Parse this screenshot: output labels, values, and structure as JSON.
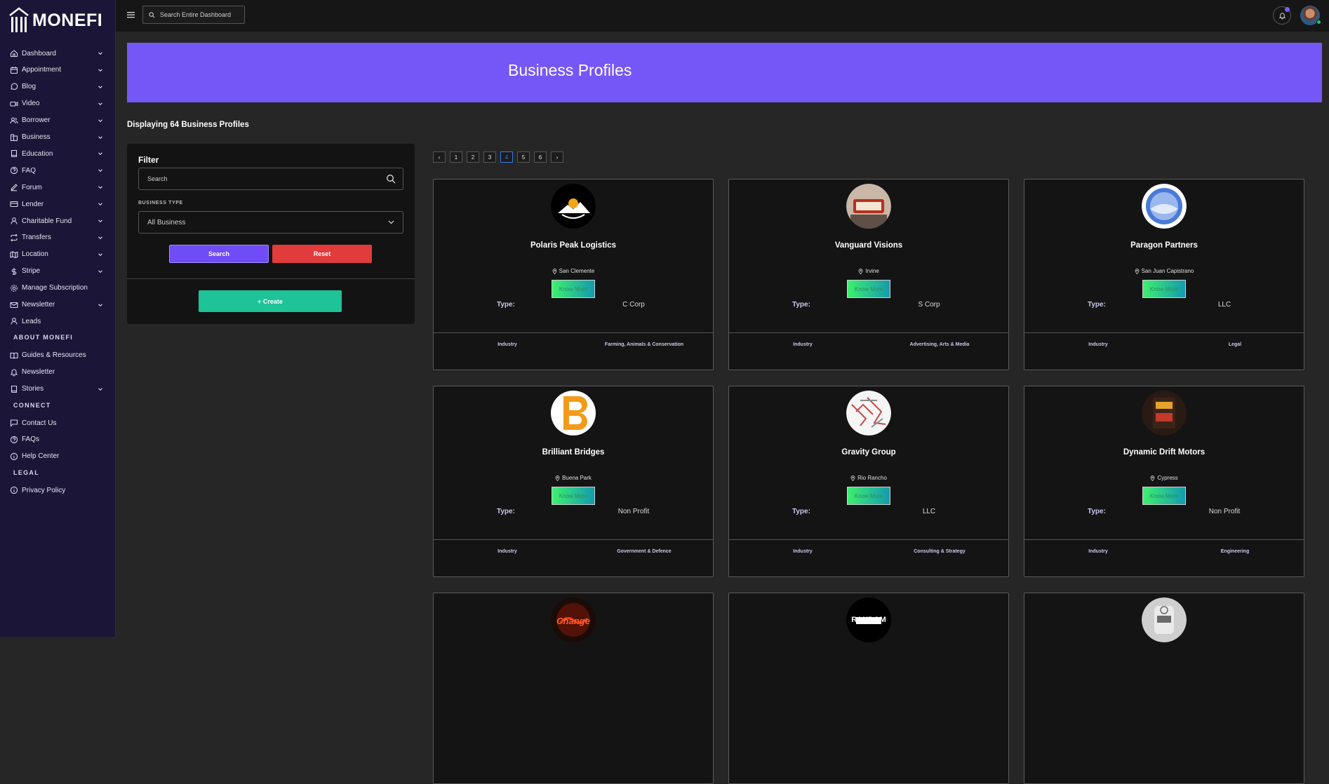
{
  "brand": {
    "name": "MONEFI"
  },
  "topbar": {
    "search_placeholder": "Search Entire Dashboard"
  },
  "sidebar": {
    "items": [
      {
        "label": "Dashboard",
        "icon": "home-icon",
        "chevron": true
      },
      {
        "label": "Appointment",
        "icon": "calendar-icon",
        "chevron": true
      },
      {
        "label": "Blog",
        "icon": "chat-icon",
        "chevron": true
      },
      {
        "label": "Video",
        "icon": "video-icon",
        "chevron": true
      },
      {
        "label": "Borrower",
        "icon": "users-icon",
        "chevron": true
      },
      {
        "label": "Business",
        "icon": "building-icon",
        "chevron": true
      },
      {
        "label": "Education",
        "icon": "book-icon",
        "chevron": true
      },
      {
        "label": "FAQ",
        "icon": "help-circle-icon",
        "chevron": true
      },
      {
        "label": "Forum",
        "icon": "edit-icon",
        "chevron": true
      },
      {
        "label": "Lender",
        "icon": "card-icon",
        "chevron": true
      },
      {
        "label": "Charitable Fund",
        "icon": "user-icon",
        "chevron": true
      },
      {
        "label": "Transfers",
        "icon": "repeat-icon",
        "chevron": true
      },
      {
        "label": "Location",
        "icon": "map-icon",
        "chevron": true
      },
      {
        "label": "Stripe",
        "icon": "dollar-icon",
        "chevron": true
      },
      {
        "label": "Manage Subscription",
        "icon": "settings-icon",
        "chevron": false
      },
      {
        "label": "Newsletter",
        "icon": "mail-icon",
        "chevron": true
      },
      {
        "label": "Leads",
        "icon": "user-icon",
        "chevron": false
      }
    ],
    "section_about": "ABOUT MONEFI",
    "about_items": [
      {
        "label": "Guides & Resources",
        "icon": "book-open-icon",
        "chevron": false
      },
      {
        "label": "Newsletter",
        "icon": "bell-icon",
        "chevron": false
      },
      {
        "label": "Stories",
        "icon": "book-icon",
        "chevron": true
      }
    ],
    "section_connect": "CONNECT",
    "connect_items": [
      {
        "label": "Contact Us",
        "icon": "message-icon",
        "chevron": false
      },
      {
        "label": "FAQs",
        "icon": "help-circle-icon",
        "chevron": false
      },
      {
        "label": "Help Center",
        "icon": "info-icon",
        "chevron": false
      }
    ],
    "section_legal": "LEGAL",
    "legal_items": [
      {
        "label": "Privacy Policy",
        "icon": "info-icon",
        "chevron": false
      }
    ]
  },
  "banner": {
    "title": "Business Profiles"
  },
  "summary": "Displaying 64 Business Profiles",
  "filter": {
    "title": "Filter",
    "search_placeholder": "Search",
    "business_type_label": "BUSINESS TYPE",
    "business_type_value": "All Business",
    "search_button": "Search",
    "reset_button": "Reset",
    "create_button": "+ Create"
  },
  "pagination": {
    "prev": "‹",
    "next": "›",
    "pages": [
      "1",
      "2",
      "3",
      "4",
      "5",
      "6"
    ],
    "active": "4"
  },
  "cards": [
    {
      "name": "Polaris Peak Logistics",
      "location": "San Clemente",
      "button": "Know More",
      "type_label": "Type:",
      "type": "C Corp",
      "industry_label": "Industry",
      "industry": "Farming, Animals & Conservation",
      "logo_colors": [
        "#000000",
        "#f2a51a",
        "#ffffff"
      ]
    },
    {
      "name": "Vanguard Visions",
      "location": "Irvine",
      "button": "Know More",
      "type_label": "Type:",
      "type": "S Corp",
      "industry_label": "Industry",
      "industry": "Advertising, Arts & Media",
      "logo_colors": [
        "#c9b7a8",
        "#b83020",
        "#5e5046"
      ]
    },
    {
      "name": "Paragon Partners",
      "location": "San Juan Capistrano",
      "button": "Know More",
      "type_label": "Type:",
      "type": "LLC",
      "industry_label": "Industry",
      "industry": "Legal",
      "logo_colors": [
        "#ffffff",
        "#4a7ad8",
        "#9ab8ee"
      ]
    },
    {
      "name": "Brilliant Bridges",
      "location": "Buena Park",
      "button": "Know More",
      "type_label": "Type:",
      "type": "Non Profit",
      "industry_label": "Industry",
      "industry": "Government & Defence",
      "logo_colors": [
        "#ffffff",
        "#f39a1b",
        "#2b2b2b"
      ]
    },
    {
      "name": "Gravity Group",
      "location": "Rio Rancho",
      "button": "Know More",
      "type_label": "Type:",
      "type": "LLC",
      "industry_label": "Industry",
      "industry": "Consulting & Strategy",
      "logo_colors": [
        "#f5f5f5",
        "#c44a4a",
        "#8a8a8a"
      ]
    },
    {
      "name": "Dynamic Drift Motors",
      "location": "Cypress",
      "button": "Know More",
      "type_label": "Type:",
      "type": "Non Profit",
      "industry_label": "Industry",
      "industry": "Engineering",
      "logo_colors": [
        "#2a1a14",
        "#e5a32b",
        "#c43a2a"
      ]
    },
    {
      "name": "",
      "location": "",
      "button": "",
      "type_label": "",
      "type": "",
      "industry_label": "",
      "industry": "",
      "logo_colors": [
        "#1a0b06",
        "#e8421a",
        "#8a1a0a"
      ]
    },
    {
      "name": "",
      "location": "",
      "button": "",
      "type_label": "",
      "type": "",
      "industry_label": "",
      "industry": "",
      "logo_colors": [
        "#000000",
        "#ffffff",
        "#000000"
      ]
    },
    {
      "name": "",
      "location": "",
      "button": "",
      "type_label": "",
      "type": "",
      "industry_label": "",
      "industry": "",
      "logo_colors": [
        "#cfcfcf",
        "#eaeaea",
        "#6a6a6a"
      ]
    }
  ],
  "partial_logo_texts": [
    "Change",
    "RANDOM"
  ]
}
